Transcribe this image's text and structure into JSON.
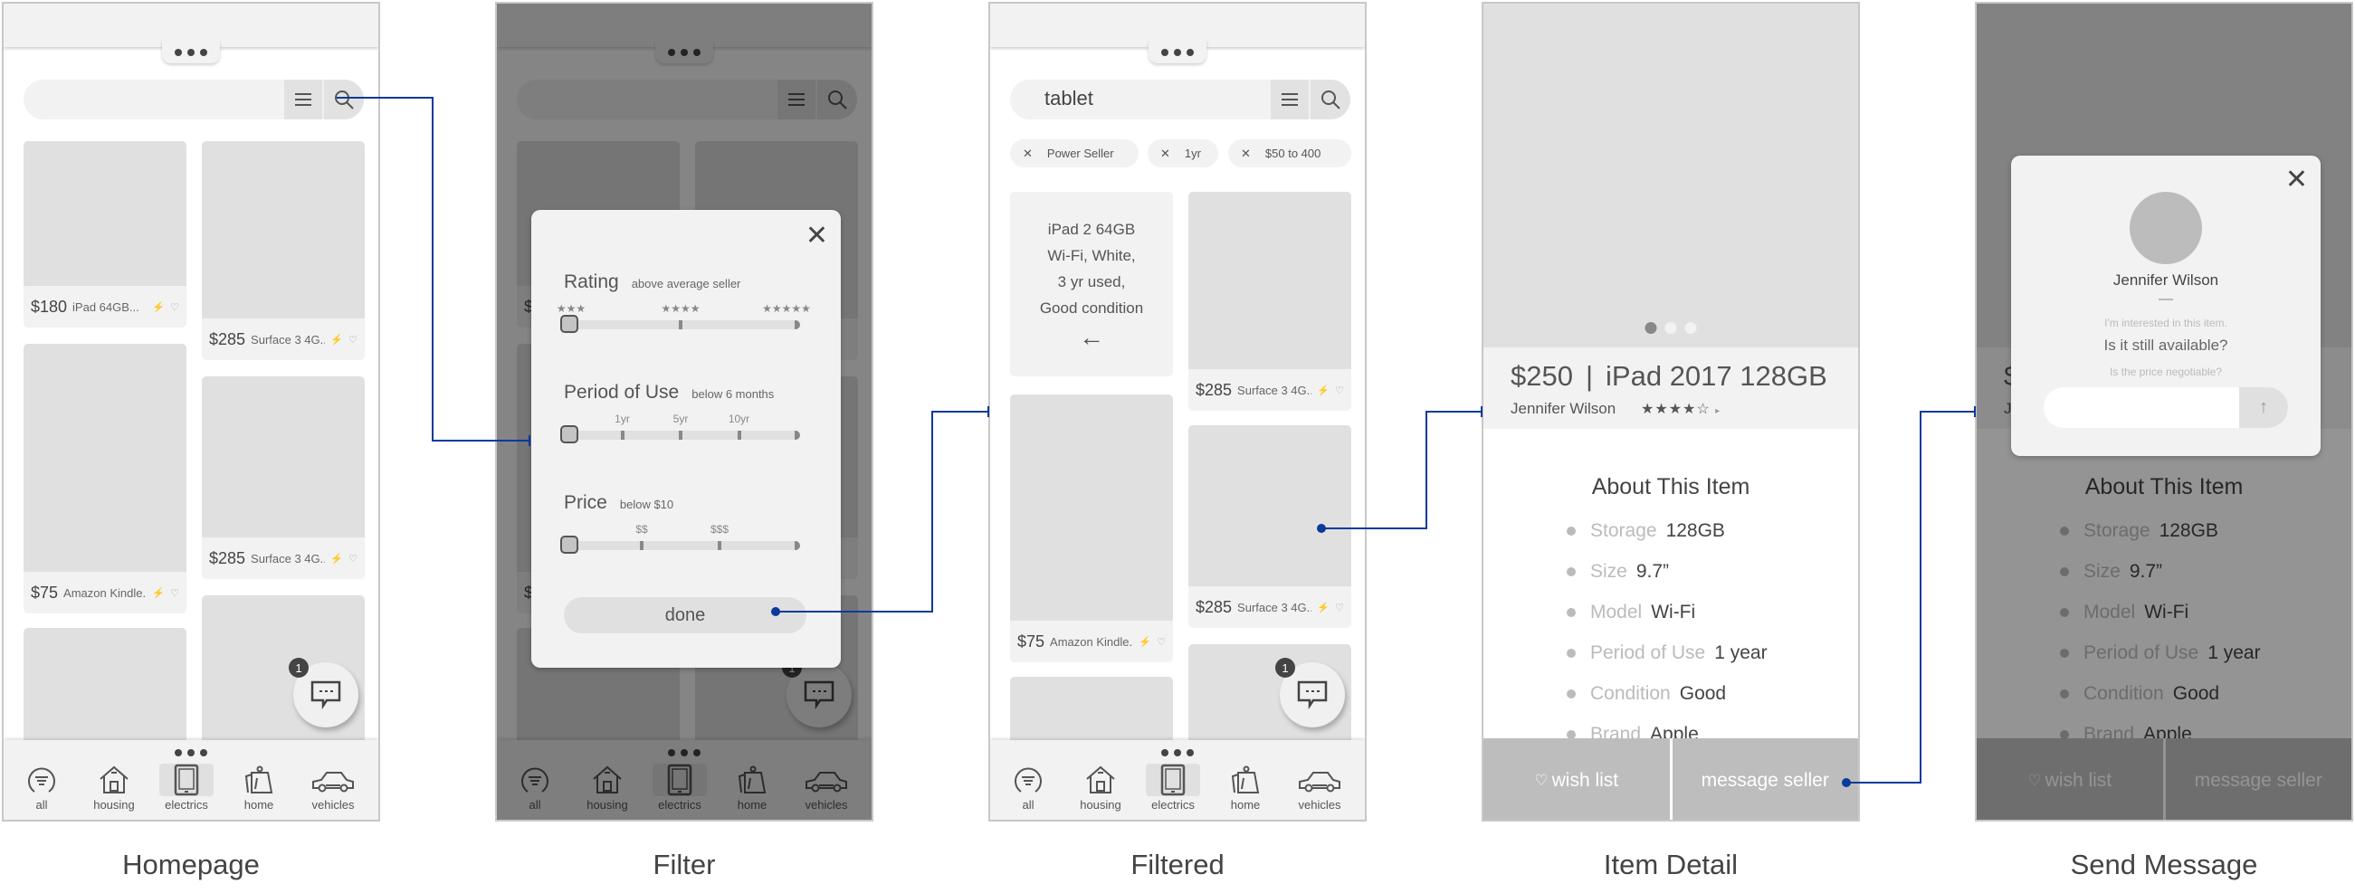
{
  "accent_color": "#0a3a9a",
  "common": {
    "categories": [
      {
        "label": "all",
        "icon": "filter-circle-icon"
      },
      {
        "label": "housing",
        "icon": "house-icon"
      },
      {
        "label": "electrics",
        "icon": "tablet-icon"
      },
      {
        "label": "home",
        "icon": "kettle-icon"
      },
      {
        "label": "vehicles",
        "icon": "car-icon"
      }
    ],
    "active_category": "electrics",
    "chat_badge": "1",
    "card_items": {
      "ipad": {
        "price": "$180",
        "title": "iPad 64GB..."
      },
      "surface": {
        "price": "$285",
        "title": "Surface 3 4G..."
      },
      "kindle": {
        "price": "$75",
        "title": "Amazon Kindle..."
      }
    }
  },
  "screens": [
    {
      "caption": "Homepage",
      "search_value": ""
    },
    {
      "caption": "Filter"
    },
    {
      "caption": "Filtered",
      "search_value": "tablet"
    },
    {
      "caption": "Item Detail"
    },
    {
      "caption": "Send Message"
    }
  ],
  "filter": {
    "rating": {
      "label": "Rating",
      "selected": "above average seller",
      "ticks": [
        "★★★",
        "★★★★",
        "★★★★★"
      ],
      "value_fraction": 0
    },
    "period": {
      "label": "Period of Use",
      "selected": "below 6 months",
      "ticks": [
        "1yr",
        "5yr",
        "10yr"
      ],
      "value_fraction": 0
    },
    "price": {
      "label": "Price",
      "selected": "below $10",
      "ticks": [
        "$$",
        "$$$"
      ],
      "value_fraction": 0
    },
    "done_label": "done"
  },
  "filtered": {
    "chips": [
      {
        "label": "Power Seller"
      },
      {
        "label": "1yr"
      },
      {
        "label": "$50 to 400"
      }
    ],
    "preview_card": {
      "lines": [
        "iPad 2 64GB",
        "Wi-Fi, White,",
        "3 yr used,",
        "Good condition"
      ],
      "back_icon": "arrow-left-icon"
    }
  },
  "item_detail": {
    "price": "$250",
    "separator": "|",
    "title": "iPad 2017 128GB",
    "seller": "Jennifer Wilson",
    "rating_stars": "★★★★☆",
    "rating_value": 4,
    "rating_max": 5,
    "carousel_count": 3,
    "carousel_active": 1,
    "about_heading": "About This Item",
    "specs": [
      {
        "key": "Storage",
        "value": "128GB"
      },
      {
        "key": "Size",
        "value": "9.7”"
      },
      {
        "key": "Model",
        "value": "Wi-Fi"
      },
      {
        "key": "Period of Use",
        "value": "1 year"
      },
      {
        "key": "Condition",
        "value": "Good"
      },
      {
        "key": "Brand",
        "value": "Apple"
      }
    ],
    "wishlist_label": "wish list",
    "message_label": "message seller"
  },
  "send_message": {
    "seller_name": "Jennifer Wilson",
    "suggestions": [
      "I'm interested in this item.",
      "Is it still available?",
      "Is the price negotiable?"
    ],
    "input_value": "",
    "input_placeholder": ""
  }
}
